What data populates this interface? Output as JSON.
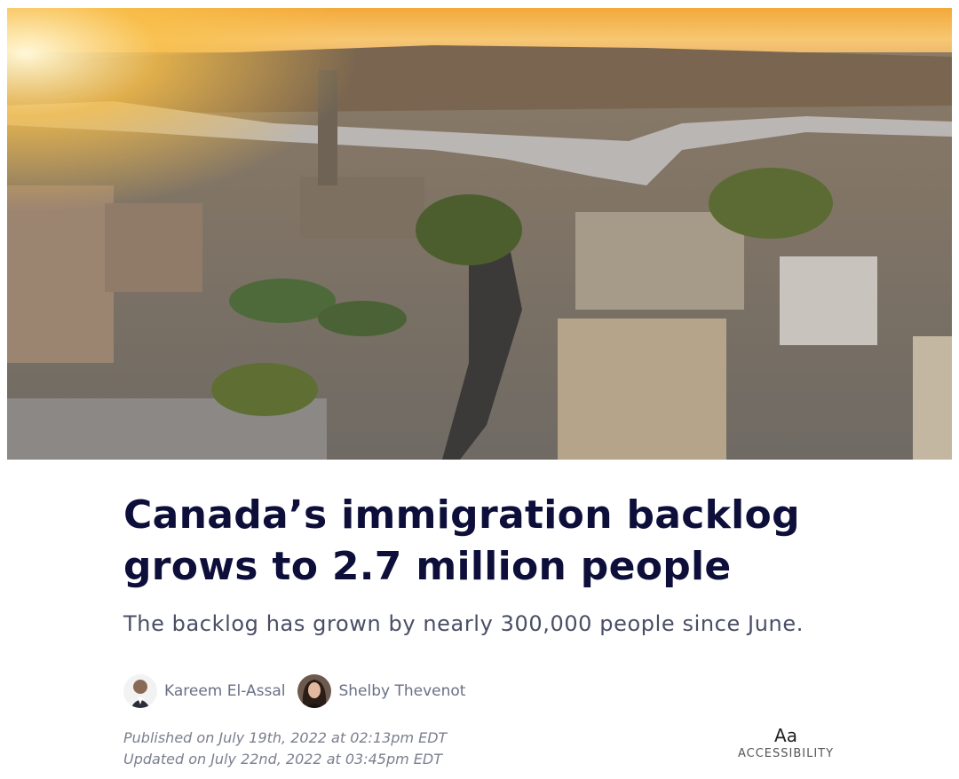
{
  "article": {
    "headline": "Canada’s immigration backlog grows to 2.7 million people",
    "subheadline": "The backlog has grown by nearly 300,000 people since June.",
    "authors": [
      {
        "name": "Kareem El-Assal"
      },
      {
        "name": "Shelby Thevenot"
      }
    ],
    "published": "Published on July 19th, 2022 at 02:13pm EDT",
    "updated": "Updated on July 22nd, 2022 at 03:45pm EDT"
  },
  "accessibility": {
    "icon_text": "Aa",
    "label": "ACCESSIBILITY"
  },
  "colors": {
    "headline": "#0d0f3a",
    "subhead": "#4a4e66",
    "author": "#6a6f86",
    "meta": "#7b7f8e"
  }
}
